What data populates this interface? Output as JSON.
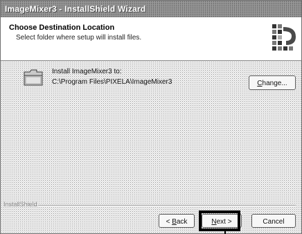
{
  "window": {
    "title": "ImageMixer3 - InstallShield Wizard"
  },
  "header": {
    "title": "Choose Destination Location",
    "subtitle": "Select folder where setup will install files.",
    "logo_icon": "installshield-logo-icon"
  },
  "destination": {
    "label": "Install ImageMixer3 to:",
    "path": "C:\\Program Files\\PIXELA\\ImageMixer3",
    "folder_icon": "folder-icon",
    "change_prefix": "",
    "change_mnemonic": "C",
    "change_rest": "hange..."
  },
  "footer": {
    "brand": "InstallShield",
    "back_prefix": "< ",
    "back_mnemonic": "B",
    "back_rest": "ack",
    "next_prefix": "",
    "next_mnemonic": "N",
    "next_rest": "ext >",
    "cancel_label": "Cancel"
  },
  "colors": {
    "title_bar": "#8d8d8d",
    "header_bg": "#ffffff",
    "focus_outline": "#000000"
  }
}
